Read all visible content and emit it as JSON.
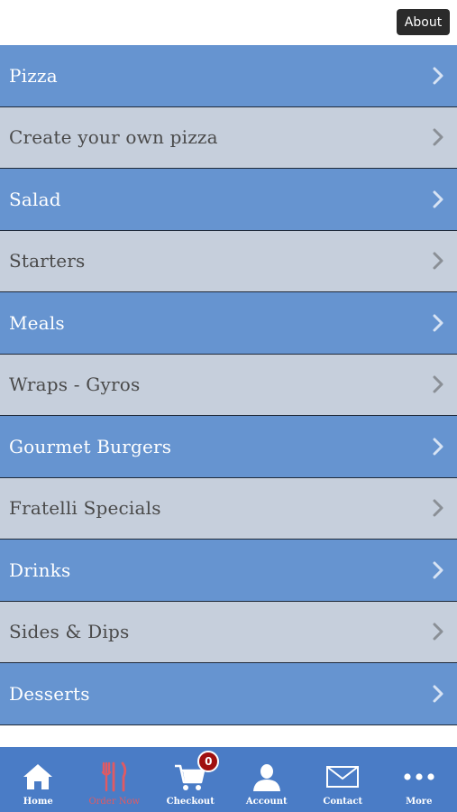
{
  "header": {
    "about_label": "About"
  },
  "menu": {
    "items": [
      {
        "label": "Pizza",
        "style": "blue"
      },
      {
        "label": "Create your own pizza",
        "style": "grey"
      },
      {
        "label": "Salad",
        "style": "blue"
      },
      {
        "label": "Starters",
        "style": "grey"
      },
      {
        "label": "Meals",
        "style": "blue"
      },
      {
        "label": "Wraps - Gyros",
        "style": "grey"
      },
      {
        "label": "Gourmet Burgers",
        "style": "blue"
      },
      {
        "label": "Fratelli Specials",
        "style": "grey"
      },
      {
        "label": "Drinks",
        "style": "blue"
      },
      {
        "label": "Sides & Dips",
        "style": "grey"
      },
      {
        "label": "Desserts",
        "style": "blue"
      }
    ]
  },
  "tabbar": {
    "tabs": [
      {
        "label": "Home",
        "icon": "home-icon"
      },
      {
        "label": "Order Now",
        "icon": "fork-knife-icon",
        "active": true
      },
      {
        "label": "Checkout",
        "icon": "cart-icon",
        "badge": "0"
      },
      {
        "label": "Account",
        "icon": "user-icon"
      },
      {
        "label": "Contact",
        "icon": "envelope-icon"
      },
      {
        "label": "More",
        "icon": "more-dots-icon"
      }
    ]
  },
  "colors": {
    "blue_row": "#6694d0",
    "grey_row": "#c6cfdc",
    "tabbar_bg": "#4a7cc6",
    "active_tab": "#e05a63",
    "badge_bg": "#a01010"
  }
}
